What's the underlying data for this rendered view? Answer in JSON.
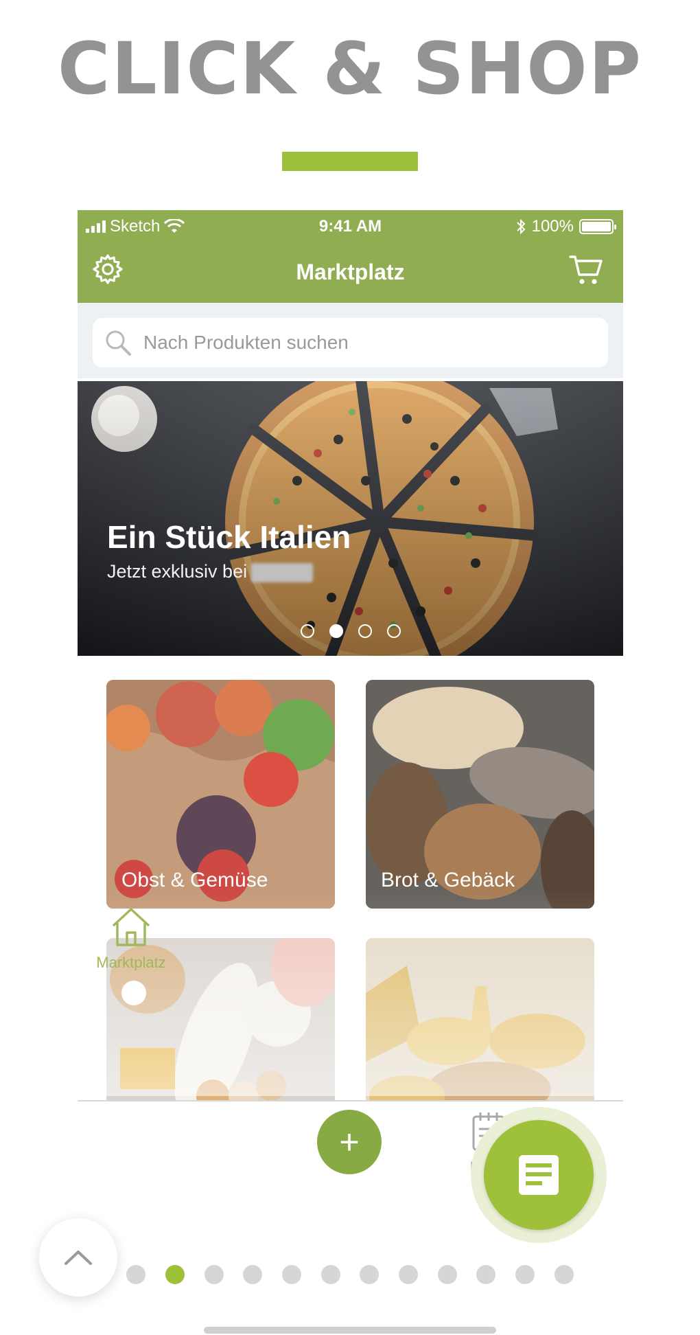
{
  "page_title": "CLICK & SHOP",
  "colors": {
    "brand_green": "#90ad52",
    "accent_green": "#9fc03b",
    "title_gray": "#939393"
  },
  "status_bar": {
    "carrier": "Sketch",
    "time": "9:41 AM",
    "battery": "100%"
  },
  "nav": {
    "title": "Marktplatz",
    "settings_icon": "gear-icon",
    "cart_icon": "cart-icon"
  },
  "search": {
    "placeholder": "Nach Produkten suchen"
  },
  "hero": {
    "title": "Ein Stück Italien",
    "subtitle": "Jetzt exklusiv bei",
    "slide_count": 4,
    "active_slide": 2
  },
  "categories": [
    {
      "label": "Obst & Gemüse"
    },
    {
      "label": "Brot & Gebäck"
    },
    {
      "label": ""
    },
    {
      "label": ""
    }
  ],
  "tabbar": {
    "home_label": "Marktplatz",
    "add_symbol": "+",
    "list_label": "Einka"
  },
  "pager": {
    "count": 12,
    "active": 2
  }
}
